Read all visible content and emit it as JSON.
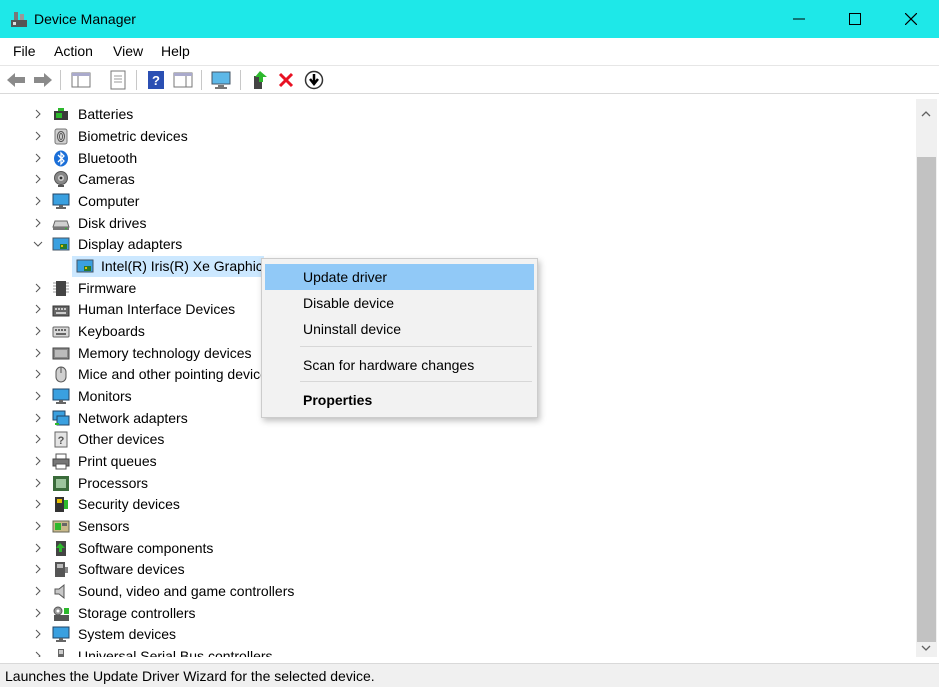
{
  "window": {
    "title": "Device Manager"
  },
  "menu": [
    "File",
    "Action",
    "View",
    "Help"
  ],
  "toolbar_icons": [
    "back-arrow-icon",
    "forward-arrow-icon",
    "show-hide-console-tree-icon",
    "properties-icon",
    "help-icon",
    "action-pane-icon",
    "scan-hardware-icon",
    "update-driver-icon",
    "uninstall-device-icon",
    "download-icon"
  ],
  "tree": {
    "items": [
      {
        "label": "Batteries",
        "icon": "battery-icon",
        "expanded": false
      },
      {
        "label": "Biometric devices",
        "icon": "fingerprint-icon",
        "expanded": false
      },
      {
        "label": "Bluetooth",
        "icon": "bluetooth-icon",
        "expanded": false
      },
      {
        "label": "Cameras",
        "icon": "camera-icon",
        "expanded": false
      },
      {
        "label": "Computer",
        "icon": "computer-icon",
        "expanded": false
      },
      {
        "label": "Disk drives",
        "icon": "disk-drive-icon",
        "expanded": false
      },
      {
        "label": "Display adapters",
        "icon": "display-adapter-icon",
        "expanded": true
      },
      {
        "label": "Intel(R) Iris(R) Xe Graphics",
        "icon": "display-adapter-icon",
        "child": true,
        "selected": true
      },
      {
        "label": "Firmware",
        "icon": "firmware-icon",
        "expanded": false
      },
      {
        "label": "Human Interface Devices",
        "icon": "hid-icon",
        "expanded": false
      },
      {
        "label": "Keyboards",
        "icon": "keyboard-icon",
        "expanded": false
      },
      {
        "label": "Memory technology devices",
        "icon": "memory-icon",
        "expanded": false
      },
      {
        "label": "Mice and other pointing devices",
        "icon": "mouse-icon",
        "expanded": false
      },
      {
        "label": "Monitors",
        "icon": "monitor-icon",
        "expanded": false
      },
      {
        "label": "Network adapters",
        "icon": "network-adapter-icon",
        "expanded": false
      },
      {
        "label": "Other devices",
        "icon": "other-devices-icon",
        "expanded": false
      },
      {
        "label": "Print queues",
        "icon": "printer-icon",
        "expanded": false
      },
      {
        "label": "Processors",
        "icon": "processor-icon",
        "expanded": false
      },
      {
        "label": "Security devices",
        "icon": "security-device-icon",
        "expanded": false
      },
      {
        "label": "Sensors",
        "icon": "sensor-icon",
        "expanded": false
      },
      {
        "label": "Software components",
        "icon": "software-component-icon",
        "expanded": false
      },
      {
        "label": "Software devices",
        "icon": "software-device-icon",
        "expanded": false
      },
      {
        "label": "Sound, video and game controllers",
        "icon": "speaker-icon",
        "expanded": false
      },
      {
        "label": "Storage controllers",
        "icon": "storage-controller-icon",
        "expanded": false
      },
      {
        "label": "System devices",
        "icon": "system-devices-icon",
        "expanded": false
      },
      {
        "label": "Universal Serial Bus controllers",
        "icon": "usb-icon",
        "expanded": false
      }
    ]
  },
  "context_menu": {
    "update_driver": "Update driver",
    "disable_device": "Disable device",
    "uninstall_device": "Uninstall device",
    "scan_hardware": "Scan for hardware changes",
    "properties": "Properties"
  },
  "status": {
    "text": "Launches the Update Driver Wizard for the selected device."
  },
  "colors": {
    "titlebar": "#1ee8e8",
    "selection": "#cce8ff",
    "menu_highlight": "#91c9f7"
  }
}
